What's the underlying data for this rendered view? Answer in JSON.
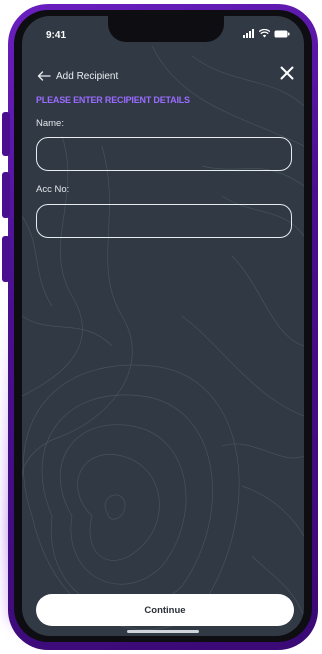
{
  "status_bar": {
    "time": "9:41",
    "icons": [
      "signal-icon",
      "wifi-icon",
      "battery-icon"
    ]
  },
  "header": {
    "title": "Add Recipient",
    "back_icon": "arrow-left-icon",
    "close_icon": "close-icon"
  },
  "subtitle": "PLEASE ENTER RECIPIENT DETAILS",
  "form": {
    "name_label": "Name:",
    "name_value": "",
    "acc_label": "Acc No:",
    "acc_value": ""
  },
  "continue_label": "Continue",
  "colors": {
    "screen_bg": "#313a44",
    "accent": "#9b6bff",
    "frame": "#4a0f8f"
  }
}
